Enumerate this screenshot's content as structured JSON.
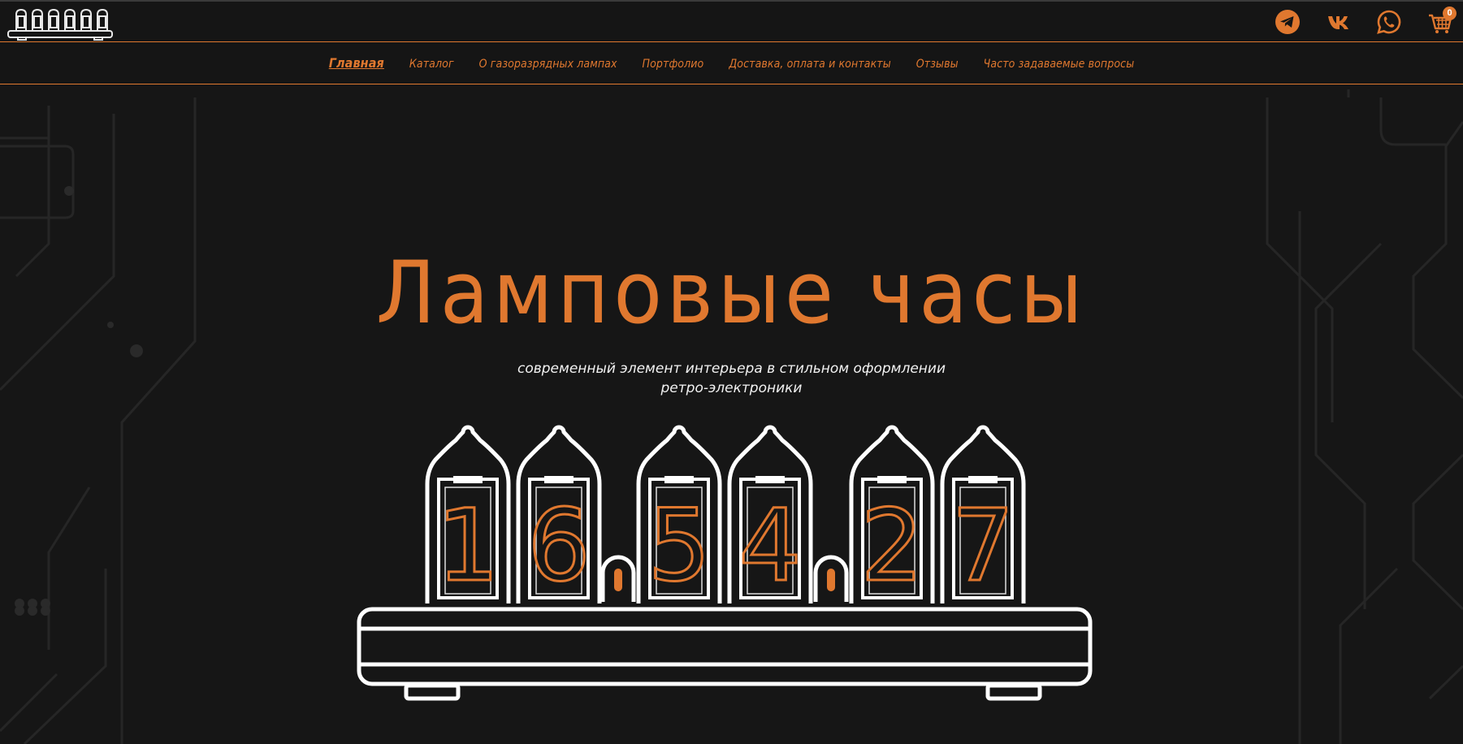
{
  "header": {
    "logo_icon": "nixie-clock-logo-icon",
    "social": [
      {
        "name": "telegram",
        "icon": "telegram-icon"
      },
      {
        "name": "vk",
        "icon": "vk-icon"
      },
      {
        "name": "whatsapp",
        "icon": "whatsapp-icon"
      }
    ],
    "cart": {
      "icon": "cart-icon",
      "count": "0"
    }
  },
  "nav": {
    "items": [
      {
        "label": "Главная",
        "active": true
      },
      {
        "label": "Каталог"
      },
      {
        "label": "О газоразрядных лампах"
      },
      {
        "label": "Портфолио"
      },
      {
        "label": "Доставка, оплата и контакты"
      },
      {
        "label": "Отзывы"
      },
      {
        "label": "Часто задаваемые вопросы"
      }
    ]
  },
  "hero": {
    "title": "Ламповые часы",
    "subtitle_line1": "современный элемент интерьера в стильном оформлении",
    "subtitle_line2": "ретро-электроники"
  },
  "clock": {
    "digits": [
      "1",
      "6",
      "5",
      "4",
      "2",
      "7"
    ]
  },
  "colors": {
    "accent": "#e0782f",
    "background": "#161616",
    "text": "#f2f2f2"
  }
}
